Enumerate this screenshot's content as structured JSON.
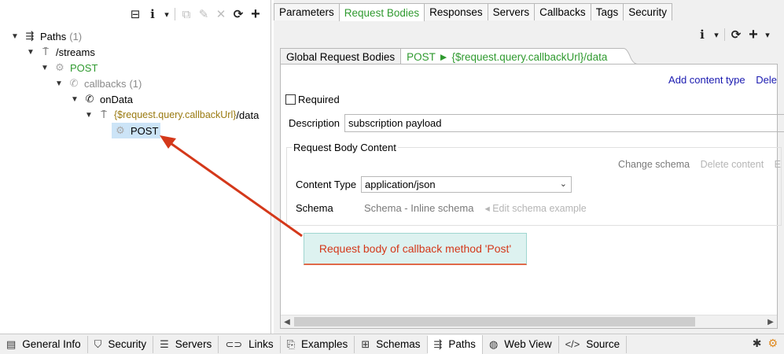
{
  "left_toolbar": {
    "collapse_icon": "⊟",
    "info_icon": "i",
    "dropdown_icon": "▾",
    "copy_icon": "⧉",
    "edit_icon": "✎",
    "delete_icon": "✕",
    "refresh_icon": "⟳",
    "add_icon": "+"
  },
  "tree": {
    "paths_label": "Paths",
    "paths_count": "(1)",
    "streams_label": "/streams",
    "post_label": "POST",
    "callbacks_label": "callbacks",
    "callbacks_count": "(1)",
    "ondata_label": "onData",
    "callback_url_expr": "{$request.query.callbackUrl}",
    "callback_url_suffix": "/data",
    "callback_post_label": "POST"
  },
  "top_tabs": [
    "Parameters",
    "Request Bodies",
    "Responses",
    "Servers",
    "Callbacks",
    "Tags",
    "Security"
  ],
  "sub_tabs": {
    "global": "Global Request Bodies",
    "current": "POST ► {$request.query.callbackUrl}/data"
  },
  "panel": {
    "add_content_type": "Add content type",
    "delete_partial": "Dele",
    "required_label": "Required",
    "description_label": "Description",
    "description_value": "subscription payload",
    "group_title": "Request Body Content",
    "change_schema": "Change schema",
    "delete_content": "Delete content",
    "edit_partial": "E",
    "content_type_label": "Content Type",
    "content_type_value": "application/json",
    "schema_label": "Schema",
    "schema_value": "Schema - Inline schema",
    "edit_schema_example": "◂ Edit schema example"
  },
  "callout": {
    "text": "Request body of callback method 'Post'"
  },
  "bottom_tabs": [
    {
      "label": "General Info",
      "icon": "general-info-icon"
    },
    {
      "label": "Security",
      "icon": "shield-icon"
    },
    {
      "label": "Servers",
      "icon": "servers-icon"
    },
    {
      "label": "Links",
      "icon": "link-icon"
    },
    {
      "label": "Examples",
      "icon": "examples-icon"
    },
    {
      "label": "Schemas",
      "icon": "schemas-icon"
    },
    {
      "label": "Paths",
      "icon": "paths-icon"
    },
    {
      "label": "Web View",
      "icon": "globe-icon"
    },
    {
      "label": "Source",
      "icon": "code-icon"
    }
  ],
  "colors": {
    "accent_green": "#2f9a2f",
    "link_blue": "#1a1ab0",
    "callout_bg": "#ddf2f0",
    "callout_text": "#d4381a",
    "arrow": "#d4381a"
  }
}
